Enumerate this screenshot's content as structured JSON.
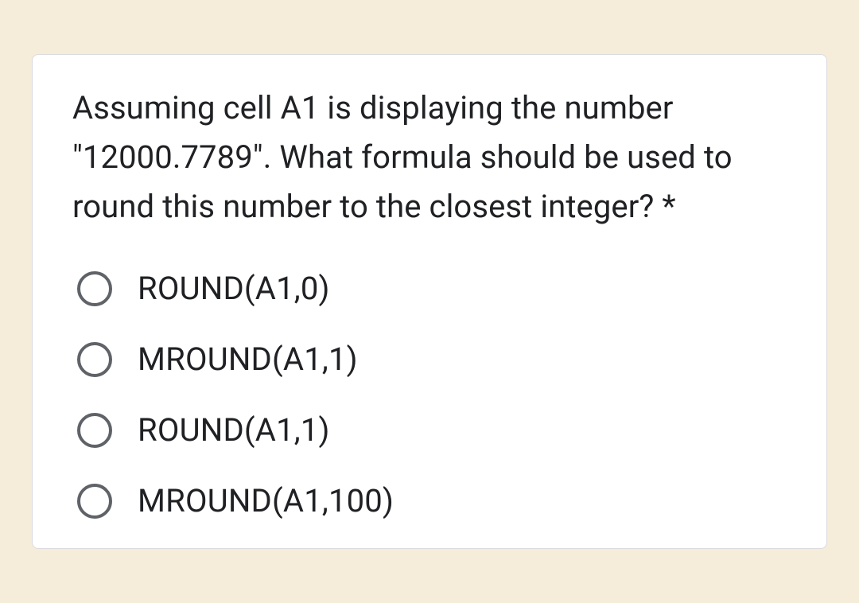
{
  "question": {
    "text": "Assuming cell A1 is displaying the number \"12000.7789\". What formula should be used to round this number to the closest integer?",
    "required_marker": " *"
  },
  "options": [
    {
      "label": "ROUND(A1,0)"
    },
    {
      "label": "MROUND(A1,1)"
    },
    {
      "label": "ROUND(A1,1)"
    },
    {
      "label": "MROUND(A1,100)"
    }
  ]
}
